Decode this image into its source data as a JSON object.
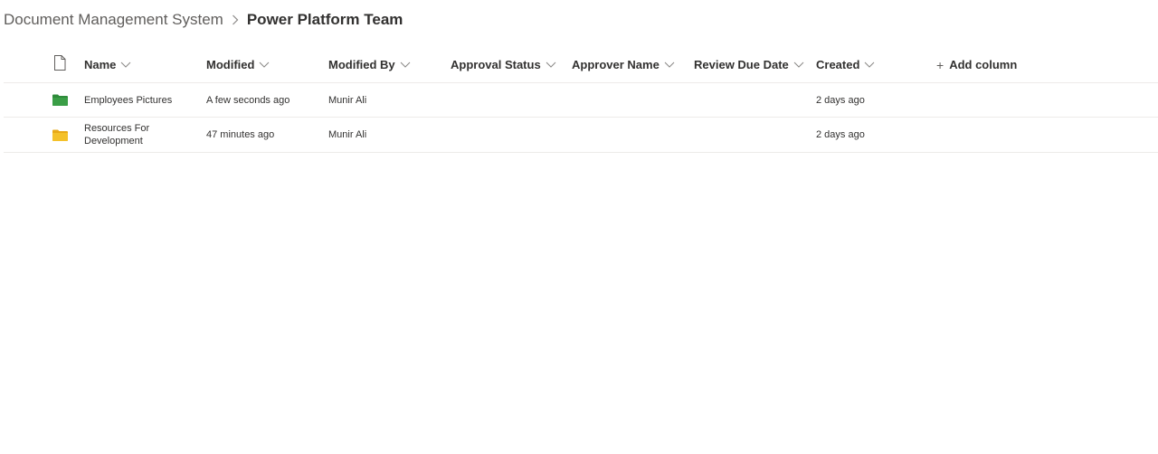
{
  "breadcrumb": {
    "parent": "Document Management System",
    "current": "Power Platform Team"
  },
  "columns": {
    "name": "Name",
    "modified": "Modified",
    "modified_by": "Modified By",
    "approval_status": "Approval Status",
    "approver_name": "Approver Name",
    "review_due_date": "Review Due Date",
    "created": "Created",
    "add_column": "Add column"
  },
  "rows": [
    {
      "name": "Employees Pictures",
      "modified": "A few seconds ago",
      "modified_by": "Munir Ali",
      "created": "2 days ago",
      "icon": "folder-green-icon",
      "icon_color": "#2e8b3a"
    },
    {
      "name": "Resources For Development",
      "modified": "47 minutes ago",
      "modified_by": "Munir Ali",
      "created": "2 days ago",
      "icon": "folder-yellow-icon",
      "icon_color": "#f4c12a"
    }
  ],
  "colors": {
    "text": "#323130",
    "muted": "#605e5c",
    "divider": "#edebe9"
  }
}
